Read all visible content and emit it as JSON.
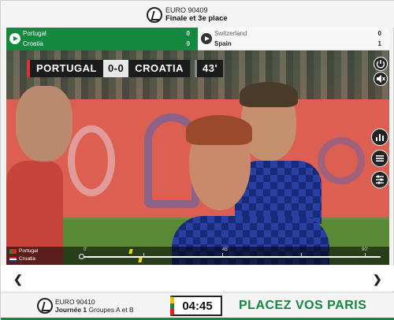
{
  "header": {
    "code": "EURO 90409",
    "stage": "Finale et 3e place"
  },
  "matches": [
    {
      "home": "Portugal",
      "home_score": "0",
      "away": "Croatia",
      "away_score": "0",
      "active": true
    },
    {
      "home": "Switzerland",
      "home_score": "0",
      "away": "Spain",
      "away_score": "1",
      "active": false
    }
  ],
  "scorebug": {
    "home": "PORTUGAL",
    "score": "0-0",
    "away": "CROATIA",
    "time": "43'"
  },
  "side_icons": [
    "power-icon",
    "mute-icon",
    "stats-icon",
    "list-icon",
    "lineup-icon"
  ],
  "timeline": {
    "team1": "Portugal",
    "team2": "Croatia",
    "markers": [
      "0'",
      "45'",
      "90'"
    ]
  },
  "footer": {
    "code": "EURO 90410",
    "round": "Journée 1",
    "groups": "Groupes A et B",
    "countdown": "04:45",
    "cta": "PLACEZ VOS PARIS"
  },
  "colors": {
    "brand_green": "#13883f",
    "card_yellow": "#f2d200"
  }
}
